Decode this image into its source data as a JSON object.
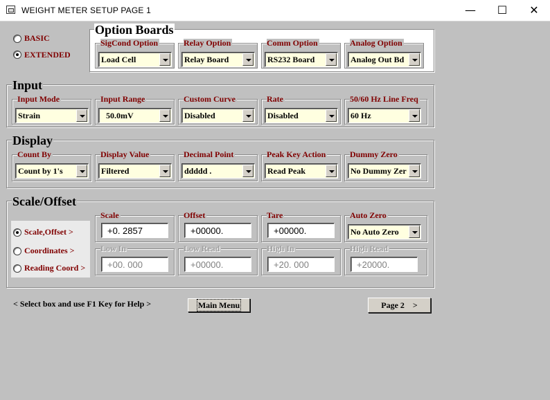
{
  "window": {
    "title": "WEIGHT METER SETUP  PAGE  1",
    "minimize": "—",
    "maximize": "☐",
    "close": "✕"
  },
  "mode": {
    "basic": "BASIC",
    "extended": "EXTENDED",
    "selected": "extended"
  },
  "option_boards": {
    "title": "Option Boards",
    "fields": [
      {
        "label": "SigCond Option",
        "value": "Load Cell"
      },
      {
        "label": "Relay Option",
        "value": "Relay Board"
      },
      {
        "label": "Comm Option",
        "value": "RS232 Board"
      },
      {
        "label": "Analog Option",
        "value": "Analog Out Bd"
      }
    ]
  },
  "input": {
    "title": "Input",
    "fields": [
      {
        "label": "Input Mode",
        "value": "Strain"
      },
      {
        "label": "Input Range",
        "value": "50.0mV"
      },
      {
        "label": "Custom Curve",
        "value": "Disabled"
      },
      {
        "label": "Rate",
        "value": "Disabled"
      },
      {
        "label": "50/60 Hz Line Freq",
        "value": "60 Hz"
      }
    ]
  },
  "display": {
    "title": "Display",
    "fields": [
      {
        "label": "Count By",
        "value": "Count by 1's"
      },
      {
        "label": "Display Value",
        "value": "Filtered"
      },
      {
        "label": "Decimal Point",
        "value": "ddddd ."
      },
      {
        "label": "Peak Key Action",
        "value": "Read Peak"
      },
      {
        "label": "Dummy Zero",
        "value": "No Dummy Zer"
      }
    ]
  },
  "scale_offset": {
    "title": "Scale/Offset",
    "radios": [
      {
        "label": "Scale,Offset  >",
        "checked": true
      },
      {
        "label": "Coordinates  >",
        "checked": false
      },
      {
        "label": "Reading Coord >",
        "checked": false
      }
    ],
    "scale": {
      "label": "Scale",
      "value": "+0. 2857"
    },
    "offset": {
      "label": "Offset",
      "value": "+00000."
    },
    "tare": {
      "label": "Tare",
      "value": "+00000."
    },
    "auto_zero": {
      "label": "Auto Zero",
      "value": "No Auto Zero"
    },
    "low_in": {
      "label": "Low In",
      "value": "+00. 000"
    },
    "low_read": {
      "label": "Low Read",
      "value": "+00000."
    },
    "high_in": {
      "label": "High In",
      "value": "+20. 000"
    },
    "high_read": {
      "label": "High Read",
      "value": "+20000."
    }
  },
  "footer": {
    "help": "<  Select box and use F1 Key for Help  >",
    "main_menu": "Main Menu",
    "page2": "Page 2    >"
  }
}
